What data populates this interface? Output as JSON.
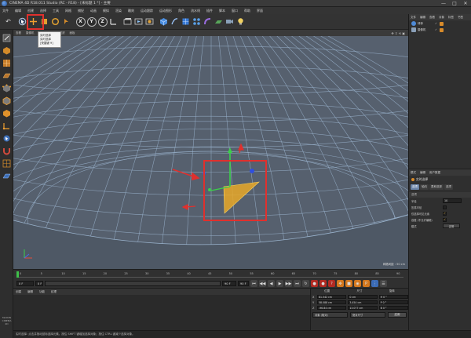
{
  "window": {
    "title": "CINEMA 4D R18.011 Studio (RC - R18) - [未标题 1 *] - 主要",
    "controls": [
      "—",
      "□",
      "✕"
    ]
  },
  "menu": {
    "items": [
      "文件",
      "编辑",
      "创建",
      "选择",
      "工具",
      "网格",
      "捕捉",
      "动画",
      "模拟",
      "渲染",
      "雕刻",
      "运动跟踪",
      "运动图形",
      "角色",
      "流水线",
      "插件",
      "脚本",
      "窗口",
      "帮助",
      "界面"
    ]
  },
  "toolbar": {
    "tooltip_lines": [
      "实时选择",
      "实时选择",
      "[快捷键 9]"
    ],
    "axis_buttons": [
      "X",
      "Y",
      "Z"
    ],
    "colors": {
      "highlight": "#e0302d"
    }
  },
  "viewport": {
    "menu": [
      "查看",
      "摄像机",
      "显示",
      "选项",
      "过滤",
      "面板"
    ],
    "grid_spacing": "网格间距 : 50 cm",
    "colors": {
      "background": "#5e6877",
      "wire": "#9ab3cd",
      "selection": "#e7a828"
    }
  },
  "timeline": {
    "ticks": [
      "0",
      "5",
      "10",
      "15",
      "20",
      "25",
      "30",
      "35",
      "40",
      "45",
      "50",
      "55",
      "60",
      "65",
      "70",
      "75",
      "80",
      "85",
      "90"
    ],
    "start_field": "0 F",
    "min_field": "0 F",
    "end_field": "90 F",
    "max_field": "90 F"
  },
  "material_panel": {
    "menu": [
      "创建",
      "编辑",
      "功能",
      "纹理"
    ]
  },
  "coordinates": {
    "headers": [
      "位置",
      "尺寸",
      "旋转"
    ],
    "rows": [
      {
        "axis": "X",
        "pos": "81.542 cm",
        "size": "0 cm",
        "rot": "H 0 °"
      },
      {
        "axis": "Y",
        "pos": "58.088 cm",
        "size": "3.454 cm",
        "rot": "P 0 °"
      },
      {
        "axis": "Z",
        "pos": "-96.84 cm",
        "size": "13.077 cm",
        "rot": "B 0 °"
      }
    ],
    "mode_select": "对象 (相对)",
    "size_select": "绝对尺寸",
    "apply_label": "应用"
  },
  "status_bar": {
    "text": "实时选择: 点击并拖动鼠标选择元素。按住 SHIFT 键增加选择对象；按住 CTRL 键减少选择对象。"
  },
  "object_manager": {
    "menu": [
      "文件",
      "编辑",
      "查看",
      "对象",
      "标签",
      "书签"
    ],
    "objects": [
      {
        "name": "球体",
        "flag": "✓"
      },
      {
        "name": "摄像机",
        "flag": "✓"
      }
    ]
  },
  "attributes": {
    "menu": [
      "模式",
      "编辑",
      "用户数据"
    ],
    "title": "实时选择",
    "tabs": [
      "选项",
      "轴向",
      "柔和选择",
      "选项"
    ],
    "section": "选项",
    "rows": [
      {
        "label": "半径",
        "value": "10"
      },
      {
        "label": "压感半径",
        "value": ""
      },
      {
        "label": "仅选择可见元素",
        "value": "✓"
      },
      {
        "label": "容差 (不允许编辑)",
        "value": "✓"
      },
      {
        "label": "模式",
        "value": "正常"
      }
    ]
  },
  "left_toolbar": {
    "brand": "MAXON CINEMA 4D"
  }
}
